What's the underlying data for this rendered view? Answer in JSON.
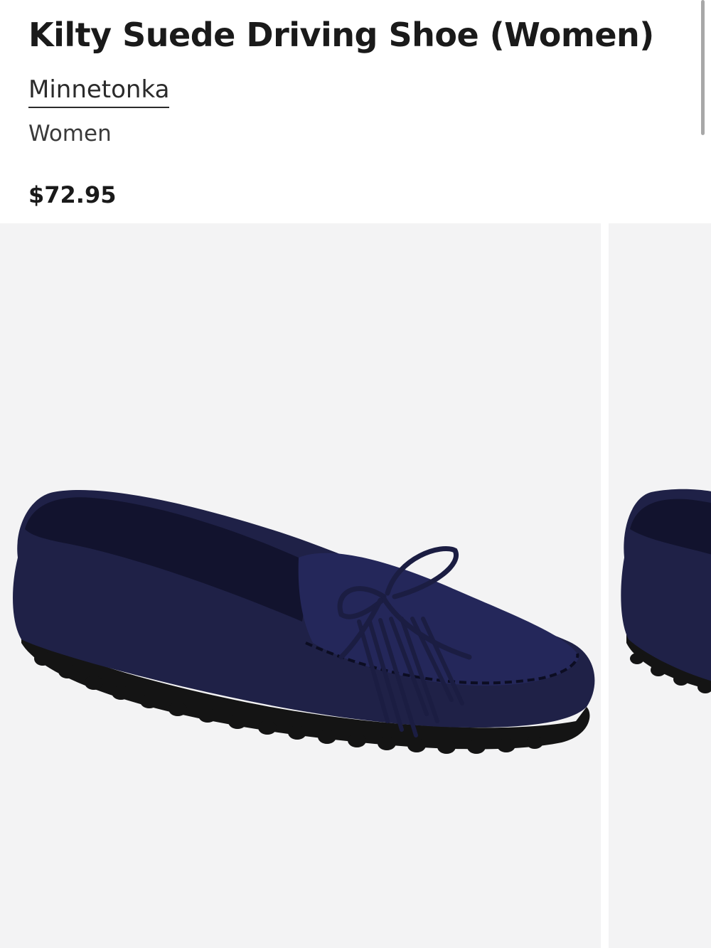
{
  "product": {
    "title": "Kilty Suede Driving Shoe (Women)",
    "brand": "Minnetonka",
    "category": "Women",
    "price": "$72.95"
  },
  "gallery": {
    "images": [
      {
        "subject": "navy suede moccasin with fringe and bow, side view",
        "active": true
      },
      {
        "subject": "navy suede moccasin, next image (partially visible)",
        "active": false
      }
    ]
  },
  "colors": {
    "shoe_suede": "#1f2147",
    "shoe_shadow": "#12132e",
    "sole": "#141414",
    "image_background": "#f3f3f4",
    "text": "#1a1a1a"
  }
}
